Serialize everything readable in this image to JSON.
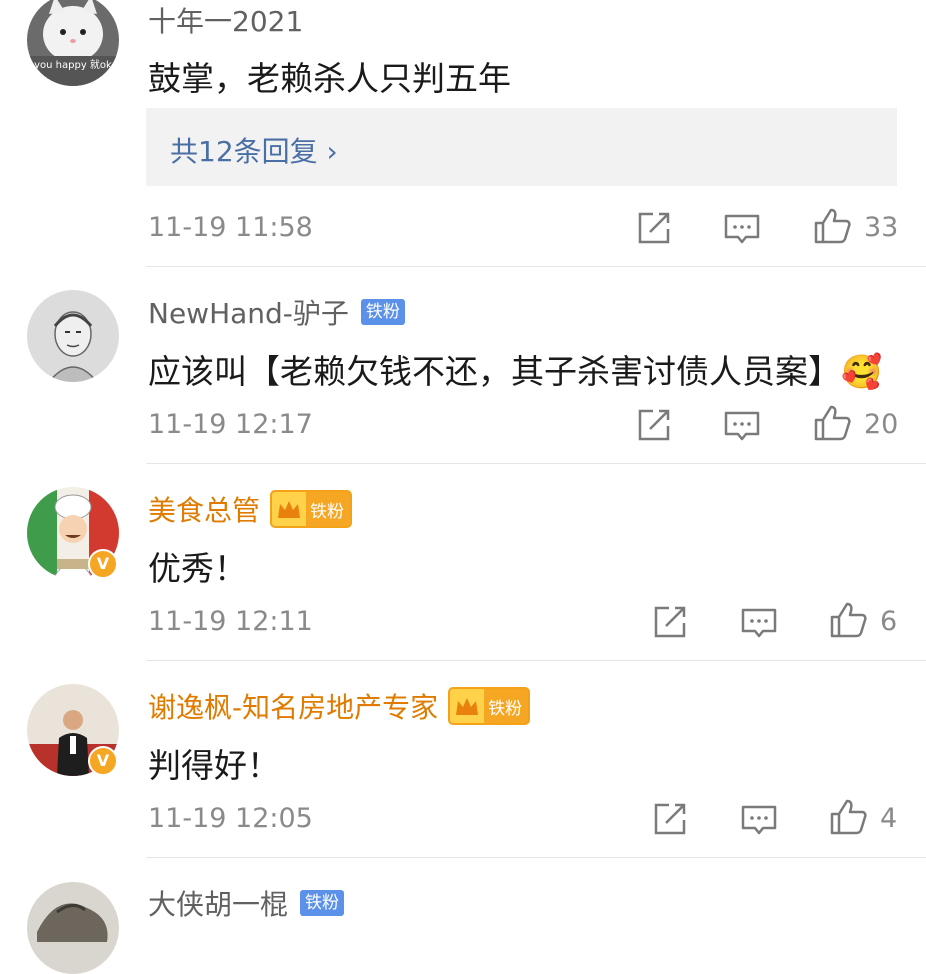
{
  "colors": {
    "fan_badge": "#5b91e8",
    "gold_name": "#e07b00",
    "reply_link": "#4a6fa5",
    "meta": "#8a8a8a"
  },
  "comments": [
    {
      "username": "十年一2021",
      "text": "鼓掌，老赖杀人只判五年",
      "reply_link": "共12条回复 ›",
      "time": "11-19 11:58",
      "likes": "33",
      "avatar_overlay_text": "you happy 就ok"
    },
    {
      "username": "NewHand-驴子",
      "fan_badge": "铁粉",
      "text": "应该叫【老赖欠钱不还，其子杀害讨债人员案】🥰",
      "time": "11-19 12:17",
      "likes": "20"
    },
    {
      "username": "美食总管",
      "fan_badge": "铁粉",
      "text": "优秀！",
      "time": "11-19 12:11",
      "likes": "6",
      "verified": "V"
    },
    {
      "username": "谢逸枫-知名房地产专家",
      "fan_badge": "铁粉",
      "text": "判得好！",
      "time": "11-19 12:05",
      "likes": "4",
      "verified": "V"
    },
    {
      "username": "大侠胡一棍",
      "fan_badge": "铁粉"
    }
  ]
}
